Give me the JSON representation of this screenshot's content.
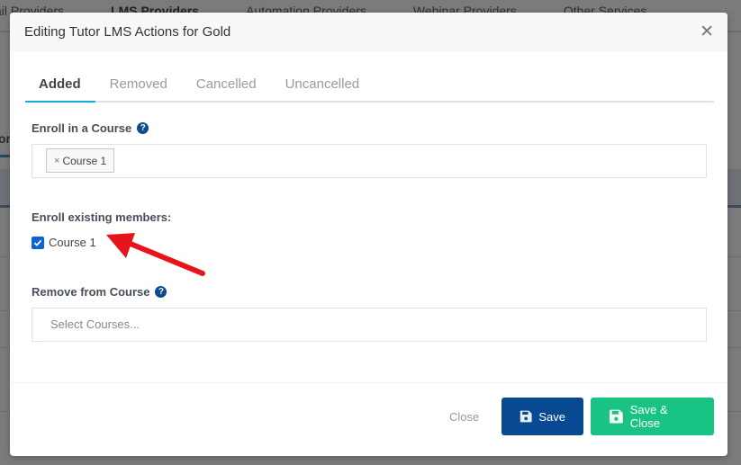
{
  "background": {
    "tabs": [
      "ail Providers",
      "LMS Providers",
      "Automation Providers",
      "Webinar Providers",
      "Other Services"
    ],
    "active_tab_index": 1,
    "left_fragment": "or"
  },
  "modal": {
    "title": "Editing Tutor LMS Actions for Gold",
    "close_icon": "close-icon",
    "tabs": [
      {
        "label": "Added",
        "active": true
      },
      {
        "label": "Removed",
        "active": false
      },
      {
        "label": "Cancelled",
        "active": false
      },
      {
        "label": "Uncancelled",
        "active": false
      }
    ],
    "enroll": {
      "label": "Enroll in a Course",
      "help_icon": "?",
      "selected": [
        {
          "label": "Course 1",
          "remove_glyph": "×"
        }
      ]
    },
    "enroll_existing": {
      "label": "Enroll existing members:",
      "options": [
        {
          "label": "Course 1",
          "checked": true
        }
      ]
    },
    "remove": {
      "label": "Remove from Course",
      "help_icon": "?",
      "placeholder": "Select Courses..."
    },
    "footer": {
      "close_label": "Close",
      "save_label": "Save",
      "save_close_label": "Save & Close"
    }
  },
  "colors": {
    "primary": "#074a92",
    "success": "#19c384",
    "tab_accent": "#17a9d8",
    "annotation_arrow": "#e8141b"
  }
}
